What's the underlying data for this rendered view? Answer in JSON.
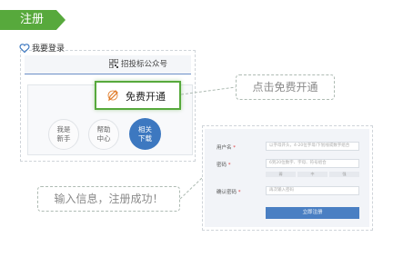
{
  "ribbon": {
    "label": "注册"
  },
  "left_panel": {
    "qr_label": "招投标公众号",
    "want_label": "我要登录",
    "free_button_label": "免费开通",
    "circles": [
      {
        "line1": "我是",
        "line2": "新手"
      },
      {
        "line1": "帮助",
        "line2": "中心"
      },
      {
        "line1": "相关",
        "line2": "下载"
      }
    ]
  },
  "callouts": {
    "free_open": "点击免费开通",
    "register_done": "输入信息，注册成功！"
  },
  "form": {
    "username_label": "用户名",
    "username_placeholder": "以字母开头，4-20位字母/下划线或数字组合",
    "password_label": "密码",
    "password_placeholder": "6到20位数字、字母、符号组合",
    "strength": [
      "弱",
      "中",
      "强"
    ],
    "confirm_label": "确认密码",
    "confirm_placeholder": "再次输入密码",
    "submit_label": "立即注册"
  },
  "colors": {
    "brand_green": "#57a93c",
    "accent_blue": "#3d78c0"
  }
}
